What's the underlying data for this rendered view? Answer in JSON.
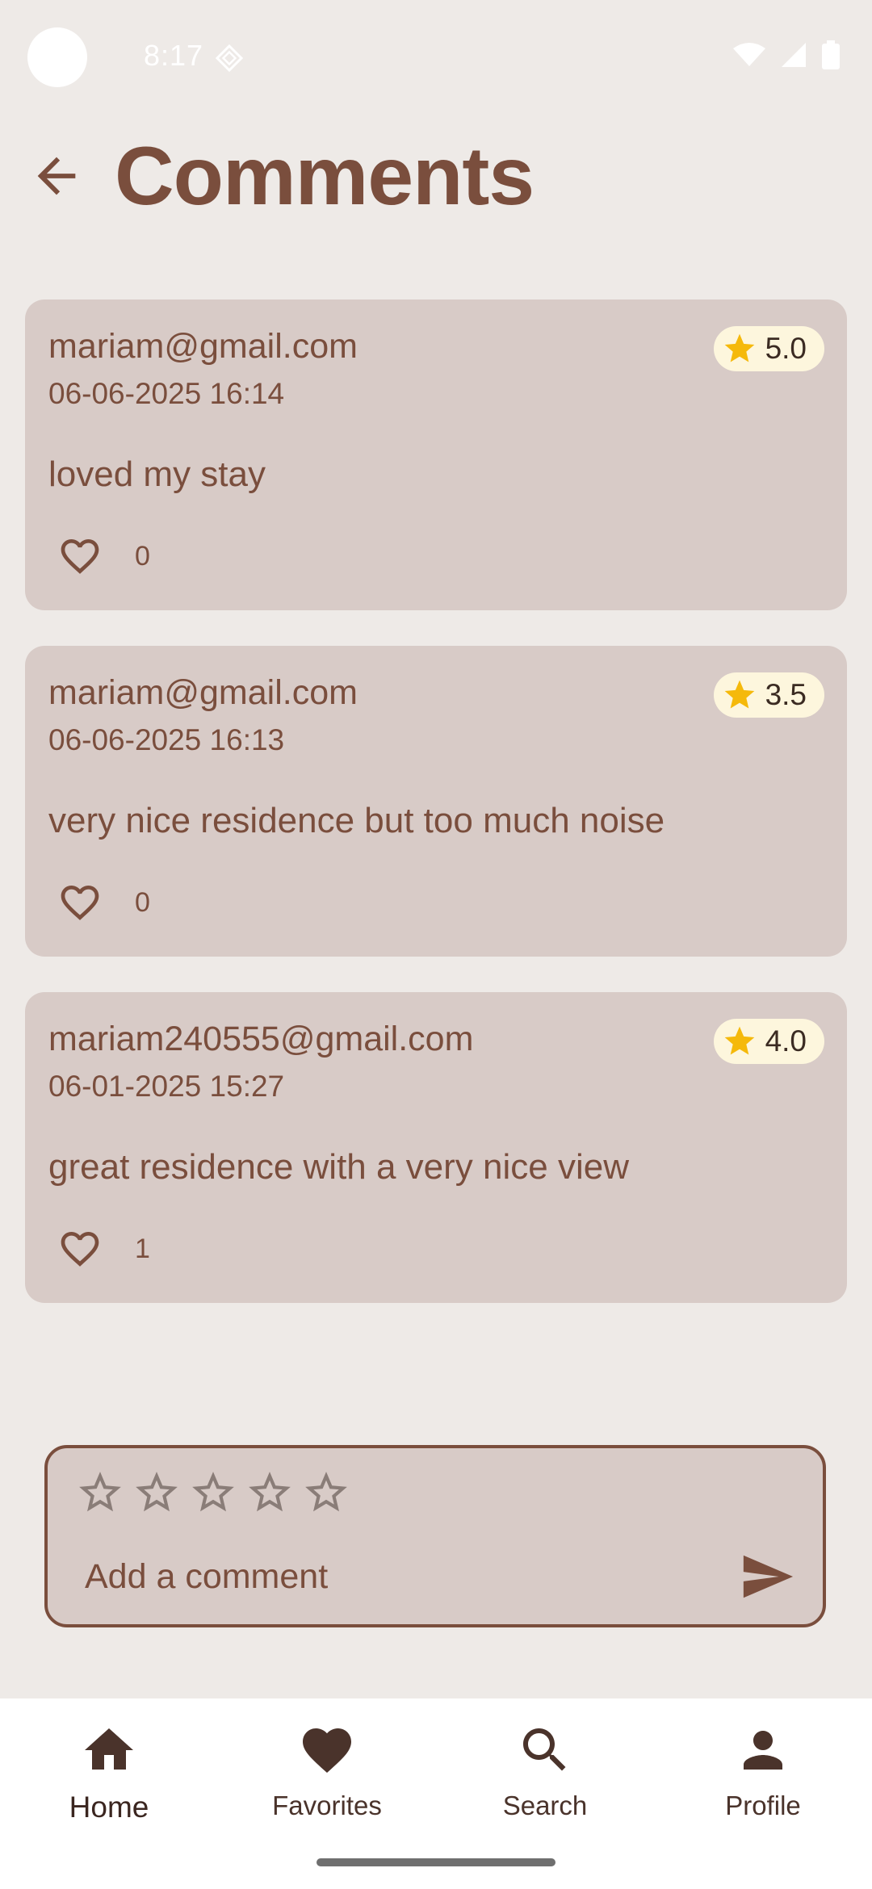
{
  "status_bar": {
    "time": "8:17"
  },
  "header": {
    "title": "Comments"
  },
  "colors": {
    "brand": "#7a4e3d",
    "card": "#d8cbc7",
    "background": "#eeeae7",
    "star": "#f5b90b",
    "badge": "#fdf6dd"
  },
  "comments": [
    {
      "email": "mariam@gmail.com",
      "date": "06-06-2025 16:14",
      "text": "loved my stay",
      "rating": "5.0",
      "likes": "0"
    },
    {
      "email": "mariam@gmail.com",
      "date": "06-06-2025 16:13",
      "text": "very nice residence but too much noise",
      "rating": "3.5",
      "likes": "0"
    },
    {
      "email": "mariam240555@gmail.com",
      "date": "06-01-2025 15:27",
      "text": "great residence with a very nice view",
      "rating": "4.0",
      "likes": "1"
    }
  ],
  "add_comment": {
    "placeholder": "Add a comment",
    "selected_stars": 0,
    "max_stars": 5
  },
  "nav": {
    "items": [
      {
        "label": "Home",
        "icon": "home-icon",
        "active": true
      },
      {
        "label": "Favorites",
        "icon": "heart-icon",
        "active": false
      },
      {
        "label": "Search",
        "icon": "search-icon",
        "active": false
      },
      {
        "label": "Profile",
        "icon": "profile-icon",
        "active": false
      }
    ]
  }
}
